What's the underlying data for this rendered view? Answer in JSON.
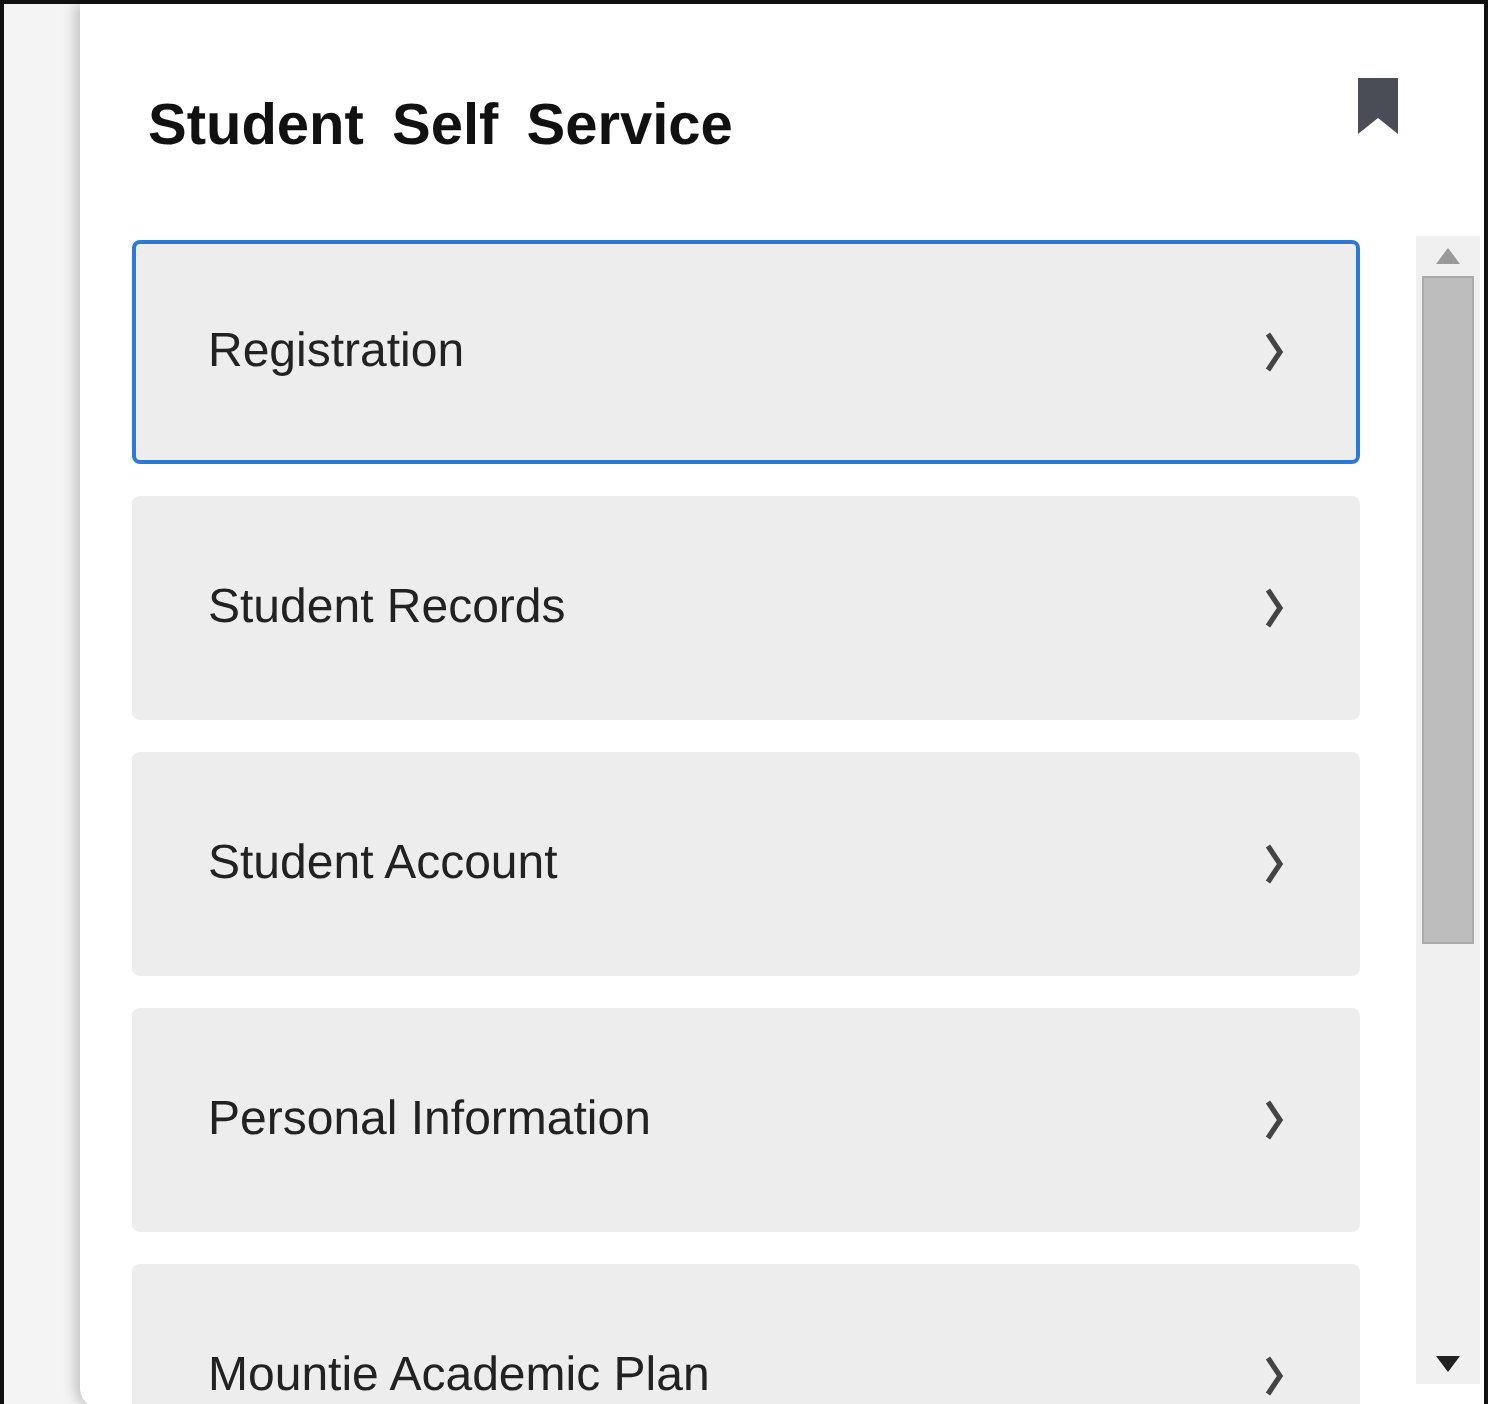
{
  "panel": {
    "title": "Student Self Service"
  },
  "items": [
    {
      "label": "Registration",
      "selected": true
    },
    {
      "label": "Student Records",
      "selected": false
    },
    {
      "label": "Student Account",
      "selected": false
    },
    {
      "label": "Personal Information",
      "selected": false
    },
    {
      "label": "Mountie Academic Plan",
      "selected": false
    }
  ]
}
